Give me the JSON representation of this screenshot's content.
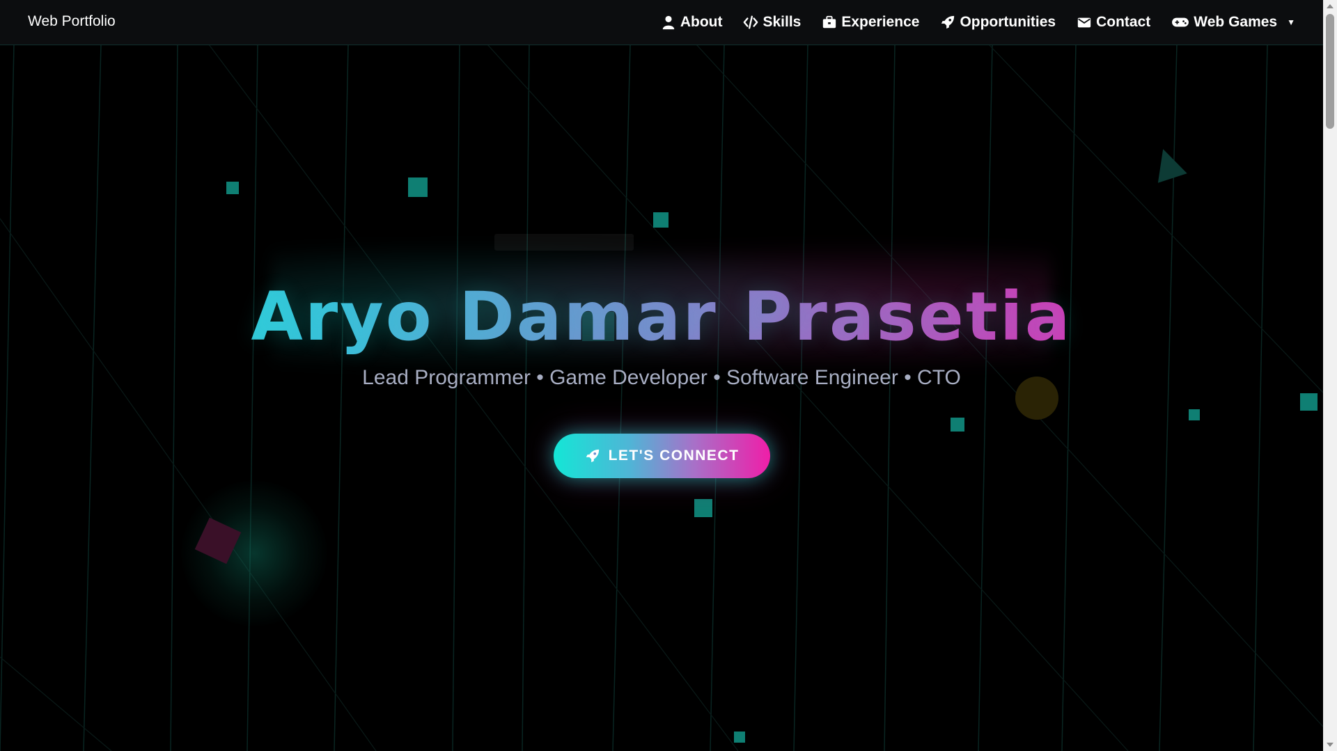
{
  "navbar": {
    "brand": "Web Portfolio",
    "items": [
      {
        "label": "About",
        "icon": "user-icon"
      },
      {
        "label": "Skills",
        "icon": "code-icon"
      },
      {
        "label": "Experience",
        "icon": "briefcase-icon"
      },
      {
        "label": "Opportunities",
        "icon": "rocket-icon"
      },
      {
        "label": "Contact",
        "icon": "envelope-icon"
      },
      {
        "label": "Web Games",
        "icon": "gamepad-icon",
        "dropdown": true
      }
    ]
  },
  "hero": {
    "title": "Aryo Damar Prasetia",
    "subtitle": "Lead Programmer • Game Developer • Software Engineer • CTO",
    "cta_label": "LET'S CONNECT",
    "cta_icon": "rocket-icon"
  },
  "colors": {
    "accent_cyan": "#18e6d9",
    "accent_magenta": "#f01ea8",
    "background": "#000000",
    "navbar_bg": "#0c0d0f",
    "subtitle": "#a8aec3"
  }
}
